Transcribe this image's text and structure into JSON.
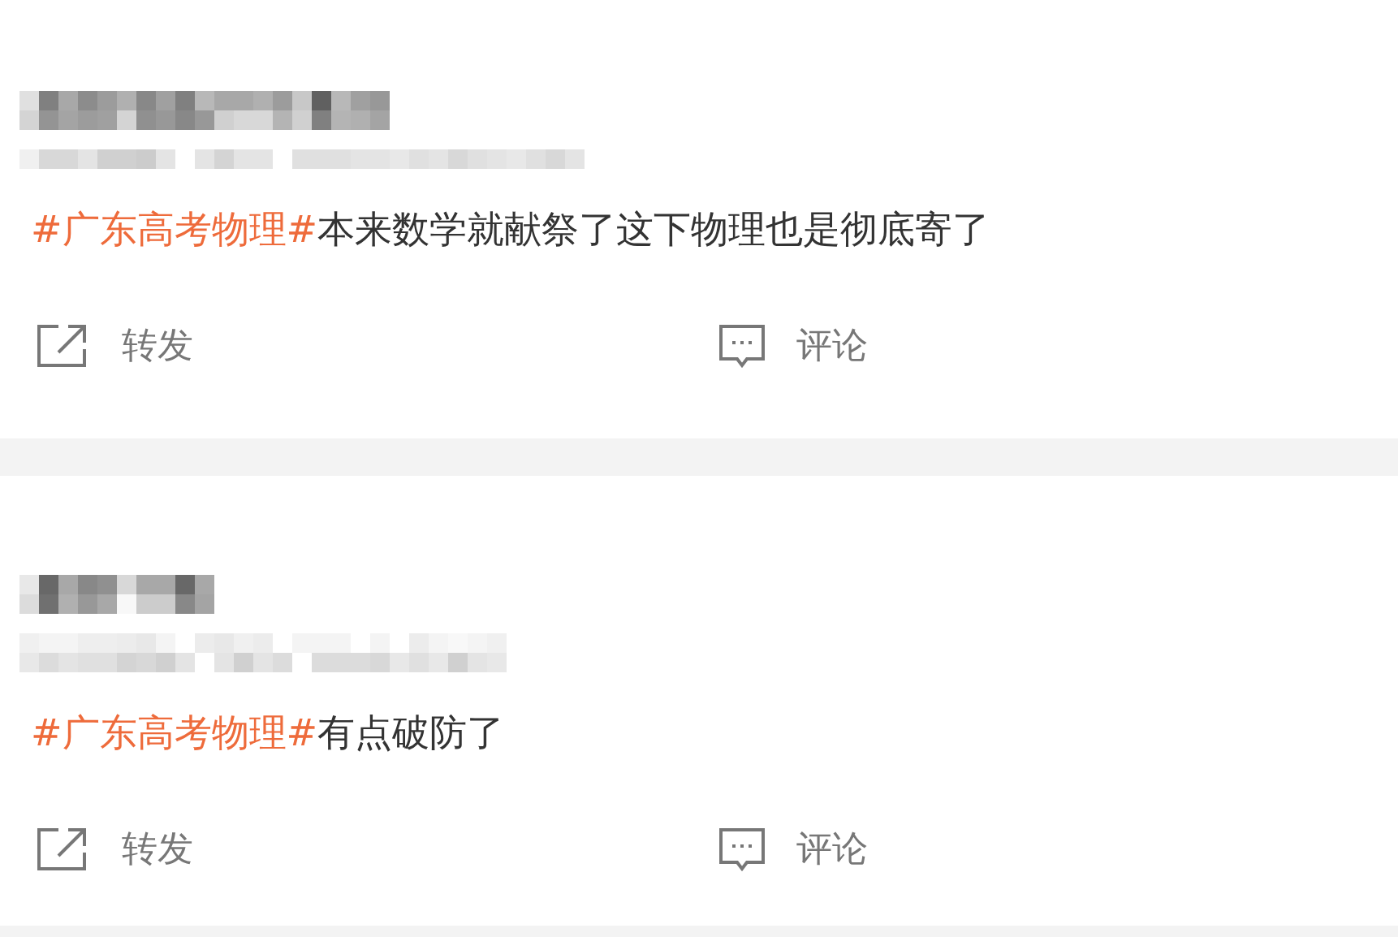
{
  "posts": [
    {
      "hashtag": "#广东高考物理#",
      "text": "本来数学就献祭了这下物理也是彻底寄了",
      "actions": [
        {
          "kind": "repost",
          "label": "转发"
        },
        {
          "kind": "comment",
          "label": "评论"
        }
      ]
    },
    {
      "hashtag": "#广东高考物理#",
      "text": "有点破防了",
      "actions": [
        {
          "kind": "repost",
          "label": "转发"
        },
        {
          "kind": "comment",
          "label": "评论"
        }
      ]
    }
  ]
}
